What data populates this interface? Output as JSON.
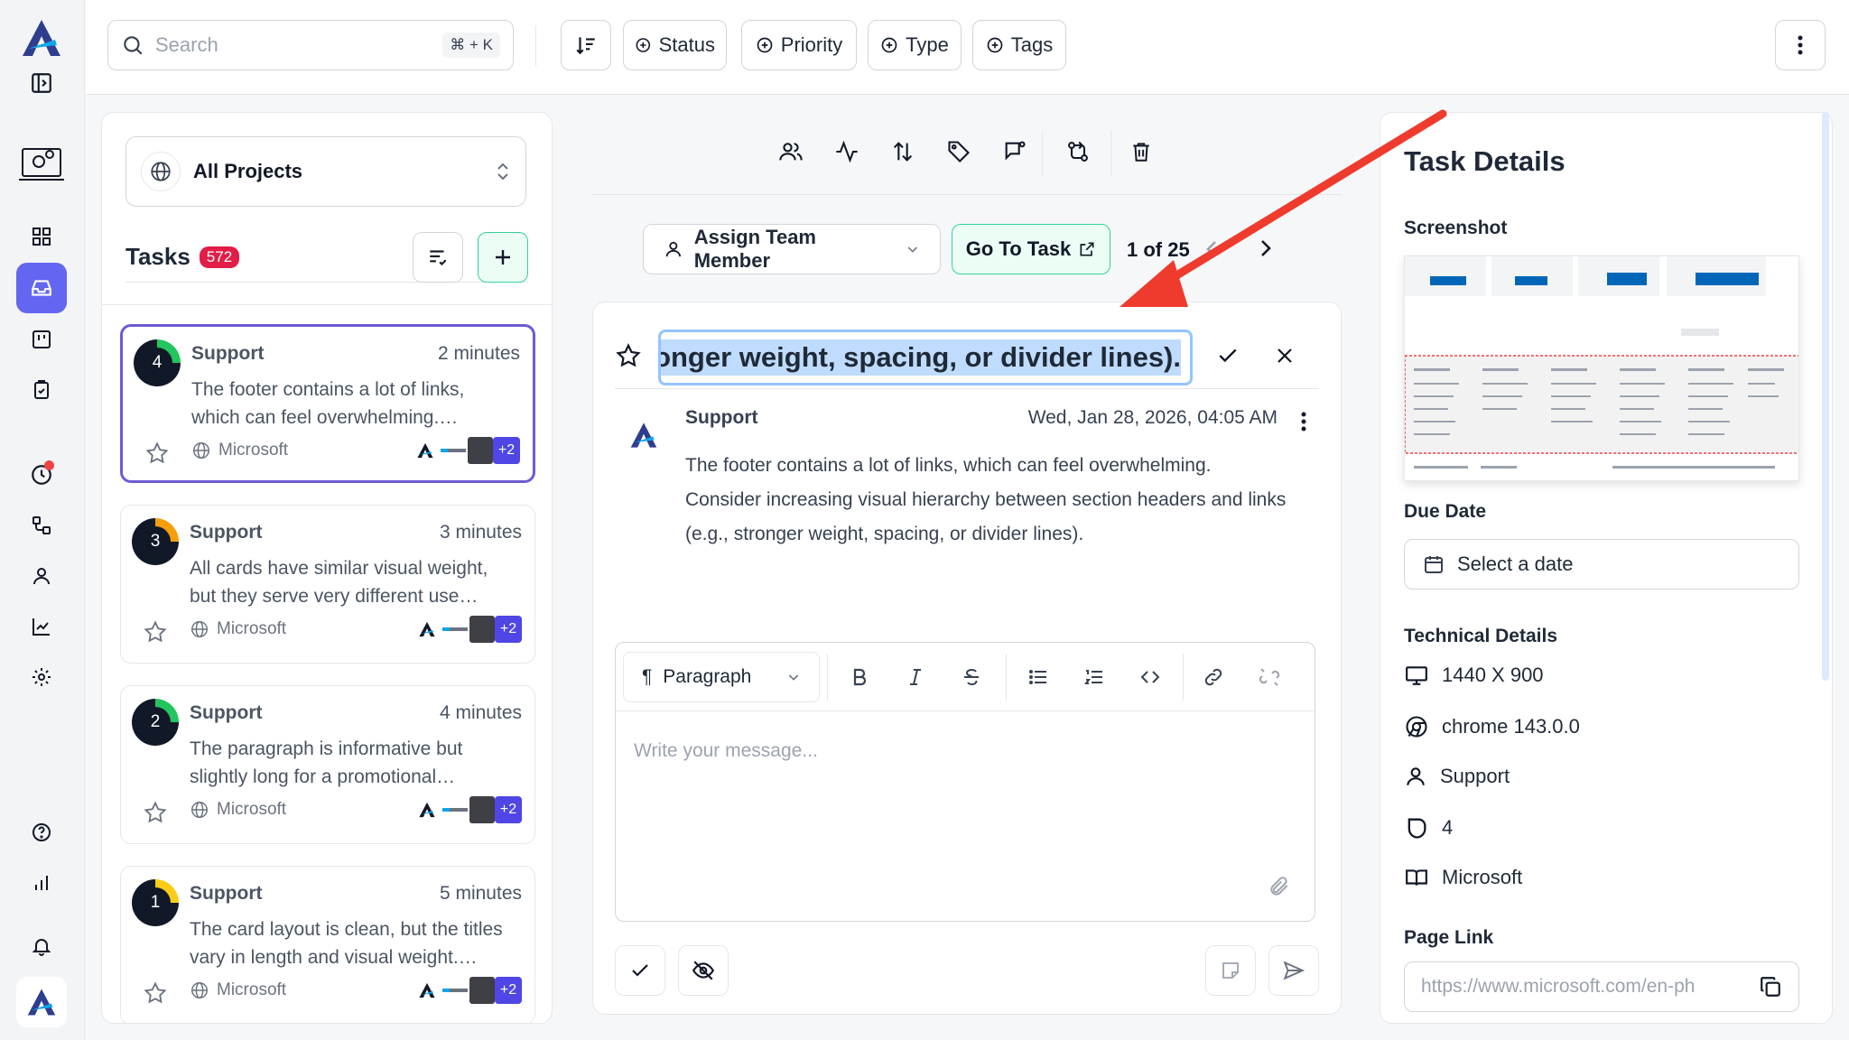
{
  "search": {
    "placeholder": "Search",
    "shortcut": "⌘ + K"
  },
  "filters": {
    "status": "Status",
    "priority": "Priority",
    "type": "Type",
    "tags": "Tags"
  },
  "projects": {
    "selected": "All Projects"
  },
  "tasks": {
    "title": "Tasks",
    "count": "572",
    "items": [
      {
        "priority": "4",
        "title": "Support",
        "time": "2 minutes",
        "desc": "The footer contains a lot of links, which can feel overwhelming.…",
        "project": "Microsoft",
        "more": "+2",
        "color": "#22c55e"
      },
      {
        "priority": "3",
        "title": "Support",
        "time": "3 minutes",
        "desc": "All cards have similar visual weight, but they serve very different use…",
        "project": "Microsoft",
        "more": "+2",
        "color": "#f59e0b"
      },
      {
        "priority": "2",
        "title": "Support",
        "time": "4 minutes",
        "desc": "The paragraph is informative but slightly long for a promotional…",
        "project": "Microsoft",
        "more": "+2",
        "color": "#22c55e"
      },
      {
        "priority": "1",
        "title": "Support",
        "time": "5 minutes",
        "desc": "The card layout is clean, but the titles vary in length and visual weight.…",
        "project": "Microsoft",
        "more": "+2",
        "color": "#facc15"
      }
    ]
  },
  "toolbar": {
    "assign": "Assign Team Member",
    "goto": "Go To Task",
    "pager": "1 of 25"
  },
  "message": {
    "title_edit": "ronger weight, spacing, or divider lines).",
    "author": "Support",
    "date": "Wed, Jan 28, 2026, 04:05 AM",
    "body": "The footer contains a lot of links, which can feel overwhelming. Consider increasing visual hierarchy between section headers and links (e.g., stronger weight, spacing, or divider lines)."
  },
  "editor": {
    "format": "Paragraph",
    "placeholder": "Write your message..."
  },
  "details": {
    "title": "Task Details",
    "screenshot_label": "Screenshot",
    "due_label": "Due Date",
    "due_placeholder": "Select a date",
    "tech_label": "Technical Details",
    "resolution": "1440 X 900",
    "browser": "chrome 143.0.0",
    "reporter": "Support",
    "priority": "4",
    "project": "Microsoft",
    "page_link_label": "Page Link",
    "page_link": "https://www.microsoft.com/en-ph"
  },
  "colors": {
    "accent": "#6366f1",
    "annotation_arrow": "#ef3b2d",
    "goto_bg": "#ecfdf5",
    "badge": "#e11d48"
  }
}
